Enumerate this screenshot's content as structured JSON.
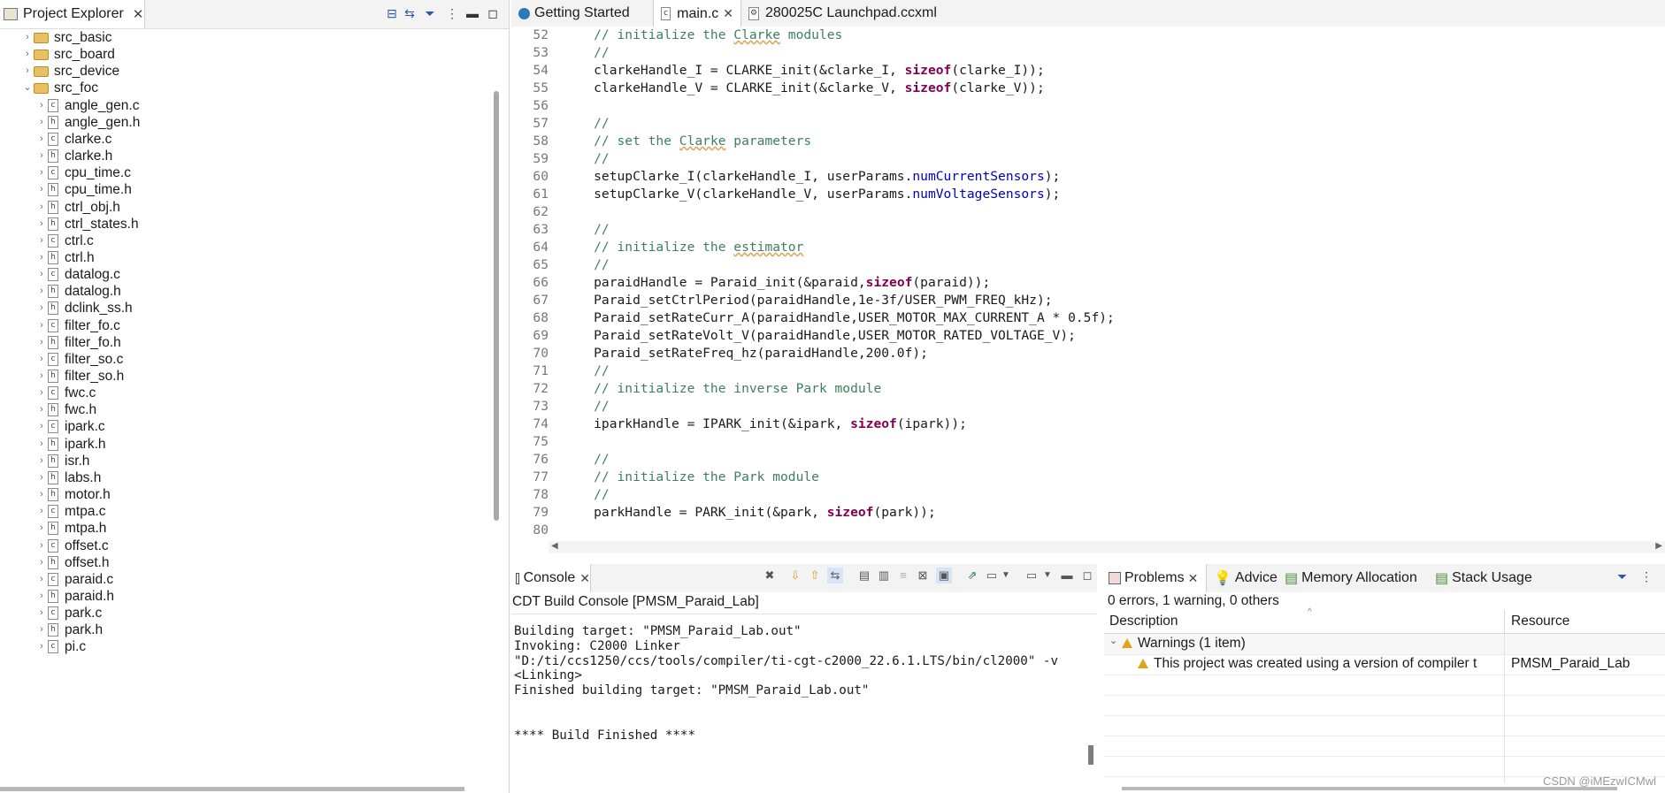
{
  "project_explorer": {
    "title": "Project Explorer",
    "folders": [
      "src_basic",
      "src_board",
      "src_device"
    ],
    "open_folder": "src_foc",
    "files": [
      "angle_gen.c",
      "angle_gen.h",
      "clarke.c",
      "clarke.h",
      "cpu_time.c",
      "cpu_time.h",
      "ctrl_obj.h",
      "ctrl_states.h",
      "ctrl.c",
      "ctrl.h",
      "datalog.c",
      "datalog.h",
      "dclink_ss.h",
      "filter_fo.c",
      "filter_fo.h",
      "filter_so.c",
      "filter_so.h",
      "fwc.c",
      "fwc.h",
      "ipark.c",
      "ipark.h",
      "isr.h",
      "labs.h",
      "motor.h",
      "mtpa.c",
      "mtpa.h",
      "offset.c",
      "offset.h",
      "paraid.c",
      "paraid.h",
      "park.c",
      "park.h",
      "pi.c"
    ]
  },
  "editor": {
    "tabs": [
      "Getting Started",
      "main.c",
      "280025C Launchpad.ccxml"
    ],
    "lines": [
      {
        "n": "52",
        "parts": [
          {
            "t": "    // initialize the ",
            "c": "cm"
          },
          {
            "t": "Clarke",
            "c": "cm squig"
          },
          {
            "t": " modules",
            "c": "cm"
          }
        ]
      },
      {
        "n": "53",
        "parts": [
          {
            "t": "    //",
            "c": "cm"
          }
        ]
      },
      {
        "n": "54",
        "parts": [
          {
            "t": "    clarkeHandle_I = CLARKE_init(&clarke_I, "
          },
          {
            "t": "sizeof",
            "c": "kw"
          },
          {
            "t": "(clarke_I));"
          }
        ]
      },
      {
        "n": "55",
        "parts": [
          {
            "t": "    clarkeHandle_V = CLARKE_init(&clarke_V, "
          },
          {
            "t": "sizeof",
            "c": "kw"
          },
          {
            "t": "(clarke_V));"
          }
        ]
      },
      {
        "n": "56",
        "parts": []
      },
      {
        "n": "57",
        "parts": [
          {
            "t": "    //",
            "c": "cm"
          }
        ]
      },
      {
        "n": "58",
        "parts": [
          {
            "t": "    // set the ",
            "c": "cm"
          },
          {
            "t": "Clarke",
            "c": "cm squig"
          },
          {
            "t": " parameters",
            "c": "cm"
          }
        ]
      },
      {
        "n": "59",
        "parts": [
          {
            "t": "    //",
            "c": "cm"
          }
        ]
      },
      {
        "n": "60",
        "parts": [
          {
            "t": "    setupClarke_I(clarkeHandle_I, userParams."
          },
          {
            "t": "numCurrentSensors",
            "c": "fld"
          },
          {
            "t": ");"
          }
        ]
      },
      {
        "n": "61",
        "parts": [
          {
            "t": "    setupClarke_V(clarkeHandle_V, userParams."
          },
          {
            "t": "numVoltageSensors",
            "c": "fld"
          },
          {
            "t": ");"
          }
        ]
      },
      {
        "n": "62",
        "parts": []
      },
      {
        "n": "63",
        "parts": [
          {
            "t": "    //",
            "c": "cm"
          }
        ]
      },
      {
        "n": "64",
        "parts": [
          {
            "t": "    // initialize the ",
            "c": "cm"
          },
          {
            "t": "estimator",
            "c": "cm squig"
          }
        ]
      },
      {
        "n": "65",
        "parts": [
          {
            "t": "    //",
            "c": "cm"
          }
        ]
      },
      {
        "n": "66",
        "parts": [
          {
            "t": "    paraidHandle = Paraid_init(&paraid,"
          },
          {
            "t": "sizeof",
            "c": "kw"
          },
          {
            "t": "(paraid));"
          }
        ]
      },
      {
        "n": "67",
        "parts": [
          {
            "t": "    Paraid_setCtrlPeriod(paraidHandle,1e-3f/USER_PWM_FREQ_kHz);"
          }
        ]
      },
      {
        "n": "68",
        "parts": [
          {
            "t": "    Paraid_setRateCurr_A(paraidHandle,USER_MOTOR_MAX_CURRENT_A * 0.5f);"
          }
        ]
      },
      {
        "n": "69",
        "parts": [
          {
            "t": "    Paraid_setRateVolt_V(paraidHandle,USER_MOTOR_RATED_VOLTAGE_V);"
          }
        ]
      },
      {
        "n": "70",
        "parts": [
          {
            "t": "    Paraid_setRateFreq_hz(paraidHandle,200.0f);"
          }
        ]
      },
      {
        "n": "71",
        "parts": [
          {
            "t": "    //",
            "c": "cm"
          }
        ]
      },
      {
        "n": "72",
        "parts": [
          {
            "t": "    // initialize the inverse Park module",
            "c": "cm"
          }
        ]
      },
      {
        "n": "73",
        "parts": [
          {
            "t": "    //",
            "c": "cm"
          }
        ]
      },
      {
        "n": "74",
        "parts": [
          {
            "t": "    iparkHandle = IPARK_init(&ipark, "
          },
          {
            "t": "sizeof",
            "c": "kw"
          },
          {
            "t": "(ipark));"
          }
        ]
      },
      {
        "n": "75",
        "parts": []
      },
      {
        "n": "76",
        "parts": [
          {
            "t": "    //",
            "c": "cm"
          }
        ]
      },
      {
        "n": "77",
        "parts": [
          {
            "t": "    // initialize the Park module",
            "c": "cm"
          }
        ]
      },
      {
        "n": "78",
        "parts": [
          {
            "t": "    //",
            "c": "cm"
          }
        ]
      },
      {
        "n": "79",
        "parts": [
          {
            "t": "    parkHandle = PARK_init(&park, "
          },
          {
            "t": "sizeof",
            "c": "kw"
          },
          {
            "t": "(park));"
          }
        ]
      },
      {
        "n": "80",
        "parts": []
      }
    ]
  },
  "console": {
    "tab": "Console",
    "subtitle": "CDT Build Console [PMSM_Paraid_Lab]",
    "lines": [
      "Building target: \"PMSM_Paraid_Lab.out\"",
      "Invoking: C2000 Linker",
      "\"D:/ti/ccs1250/ccs/tools/compiler/ti-cgt-c2000_22.6.1.LTS/bin/cl2000\" -v",
      "<Linking>",
      "Finished building target: \"PMSM_Paraid_Lab.out\"",
      "",
      "",
      "**** Build Finished ****"
    ]
  },
  "problems": {
    "tabs": [
      "Problems",
      "Advice",
      "Memory Allocation",
      "Stack Usage"
    ],
    "summary": "0 errors, 1 warning, 0 others",
    "col_description": "Description",
    "col_resource": "Resource",
    "group": "Warnings (1 item)",
    "item_description": "This project was created using a version of compiler t",
    "item_resource": "PMSM_Paraid_Lab"
  },
  "watermark": "CSDN @iMEzwICMwl"
}
